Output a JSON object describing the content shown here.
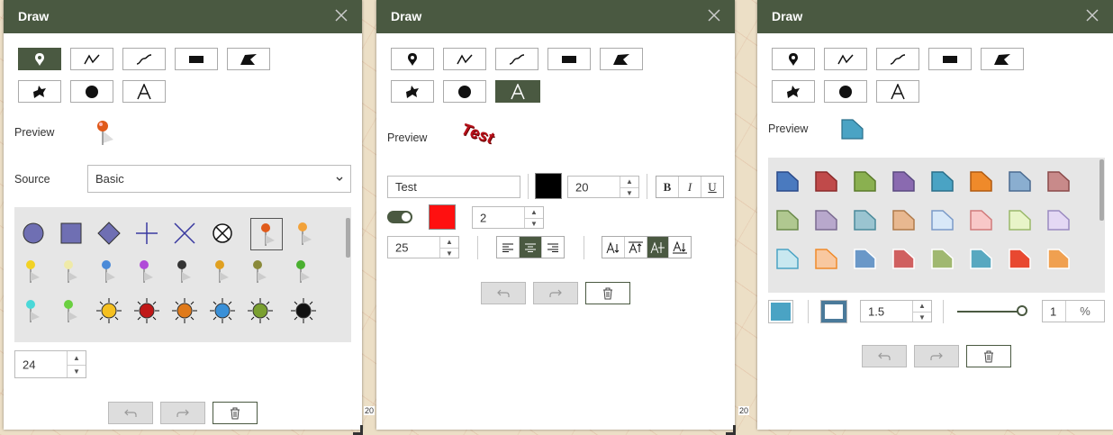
{
  "panels": [
    {
      "title": "Draw"
    },
    {
      "title": "Draw"
    },
    {
      "title": "Draw"
    }
  ],
  "panel1": {
    "preview_label": "Preview",
    "source_label": "Source",
    "source_value": "Basic",
    "size_value": "24"
  },
  "panel2": {
    "preview_label": "Preview",
    "preview_text": "Test",
    "text_value": "Test",
    "font_size": "20",
    "halo_size": "2",
    "angle_value": "25",
    "bold_label": "B",
    "italic_label": "I",
    "underline_label": "U",
    "text_color": "#000000",
    "halo_color": "#ff0000"
  },
  "panel3": {
    "preview_label": "Preview",
    "outline_width": "1.5",
    "transparency_value": "1",
    "transparency_unit": "%",
    "fill_color": "#4aa3c4"
  },
  "map_labels": {
    "scale_a": "20",
    "scale_b": "20"
  },
  "colors": {
    "header": "#4a5941",
    "accent": "#4a5941"
  }
}
